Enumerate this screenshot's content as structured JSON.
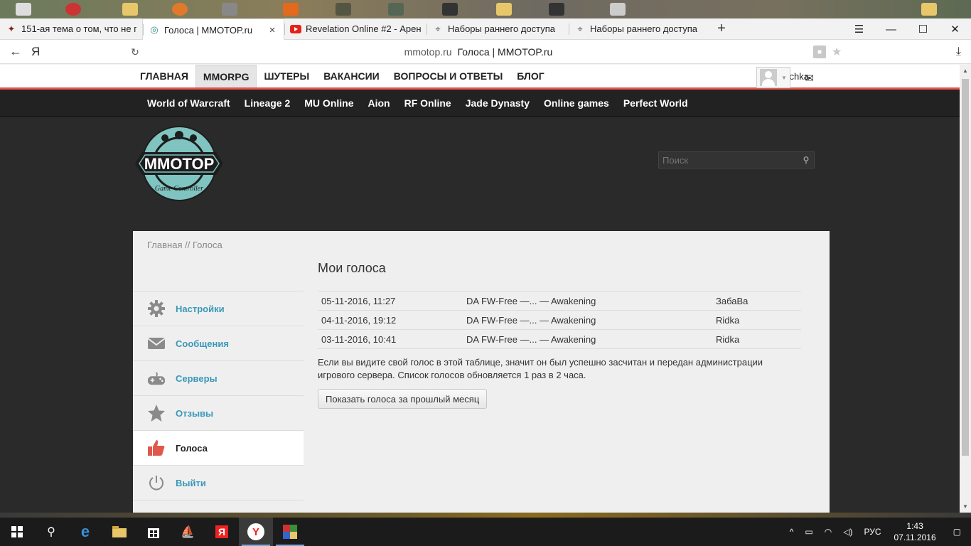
{
  "browser": {
    "tabs": [
      {
        "title": "151-ая тема о том, что не п",
        "icon": "game-favicon-icon"
      },
      {
        "title": "Голоса | MMOTOP.ru",
        "icon": "mmotop-favicon-icon",
        "active": true
      },
      {
        "title": "Revelation Online #2 - Арен",
        "icon": "youtube-favicon-icon"
      },
      {
        "title": "Наборы раннего доступа",
        "icon": "crosshair-favicon-icon"
      },
      {
        "title": "Наборы раннего доступа",
        "icon": "crosshair-favicon-icon"
      }
    ],
    "url_domain": "mmotop.ru",
    "url_title": "Голоса | MMOTOP.ru"
  },
  "site": {
    "menu": [
      "ГЛАВНАЯ",
      "MMORPG",
      "ШУТЕРЫ",
      "ВАКАНСИИ",
      "ВОПРОСЫ И ОТВЕТЫ",
      "БЛОГ"
    ],
    "active_menu": "MMORPG",
    "username": "Svetysichka",
    "games": [
      "World of Warcraft",
      "Lineage 2",
      "MU Online",
      "Aion",
      "RF Online",
      "Jade Dynasty",
      "Online games",
      "Perfect World"
    ],
    "logo_text": "MMOTOP",
    "logo_subtext": "Game Controller",
    "search_placeholder": "Поиск"
  },
  "breadcrumb": {
    "home": "Главная",
    "sep": " // ",
    "current": "Голоса"
  },
  "sidebar": [
    {
      "label": "Настройки",
      "icon": "gear-icon"
    },
    {
      "label": "Сообщения",
      "icon": "envelope-icon"
    },
    {
      "label": "Серверы",
      "icon": "gamepad-icon"
    },
    {
      "label": "Отзывы",
      "icon": "star-icon"
    },
    {
      "label": "Голоса",
      "icon": "thumbs-up-icon",
      "active": true
    },
    {
      "label": "Выйти",
      "icon": "power-icon"
    }
  ],
  "main": {
    "title": "Мои голоса",
    "votes": [
      {
        "date": "05-11-2016, 11:27",
        "server": "DA FW-Free —... — Awakening",
        "user": "ЗабаВа"
      },
      {
        "date": "04-11-2016, 19:12",
        "server": "DA FW-Free —... — Awakening",
        "user": "Ridka"
      },
      {
        "date": "03-11-2016, 10:41",
        "server": "DA FW-Free —... — Awakening",
        "user": "Ridka"
      }
    ],
    "note": "Если вы видите свой голос в этой таблице, значит он был успешно засчитан и передан администрации игрового сервера. Список голосов обновляется 1 раз в 2 часа.",
    "button": "Показать голоса за прошлый месяц"
  },
  "taskbar": {
    "lang": "РУС",
    "time": "1:43",
    "date": "07.11.2016"
  },
  "colors": {
    "accent": "#e2574c",
    "link": "#3a98b9",
    "logo_teal": "#7fc4c0"
  }
}
